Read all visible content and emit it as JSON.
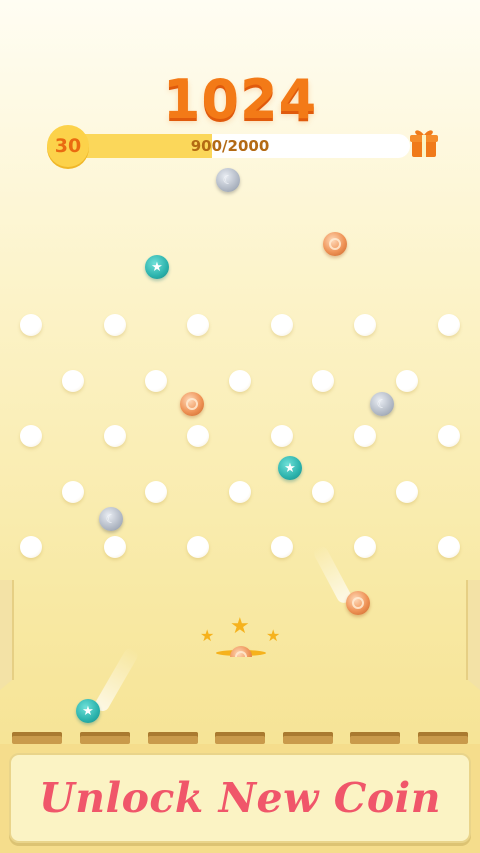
{
  "hud": {
    "score": "1024",
    "level": "30",
    "progress_text": "900/2000",
    "progress_current": 900,
    "progress_max": 2000,
    "gift_icon": "gift-icon"
  },
  "colors": {
    "score": "#f37a17",
    "progress_fill": "#fbd75a",
    "button_text": "#f0566a",
    "teal_coin": "#2bb2ac",
    "bronze_coin": "#ef9356",
    "silver_coin": "#a8b0bd"
  },
  "board": {
    "peg_rows": 5,
    "pegs_per_row_pattern": [
      6,
      5,
      6,
      5,
      6
    ],
    "coins": [
      {
        "type": "silver",
        "icon": "moon-icon"
      },
      {
        "type": "bronze",
        "icon": "ring-icon"
      },
      {
        "type": "teal",
        "icon": "star-icon"
      },
      {
        "type": "bronze",
        "icon": "ring-icon"
      },
      {
        "type": "silver",
        "icon": "moon-icon"
      },
      {
        "type": "teal",
        "icon": "star-icon"
      },
      {
        "type": "silver",
        "icon": "moon-icon"
      },
      {
        "type": "bronze",
        "icon": "ring-icon"
      },
      {
        "type": "teal",
        "icon": "star-icon"
      },
      {
        "type": "bronze",
        "icon": "ring-icon"
      }
    ],
    "slot_count": 7
  },
  "action": {
    "unlock_label": "Unlock New Coin"
  }
}
